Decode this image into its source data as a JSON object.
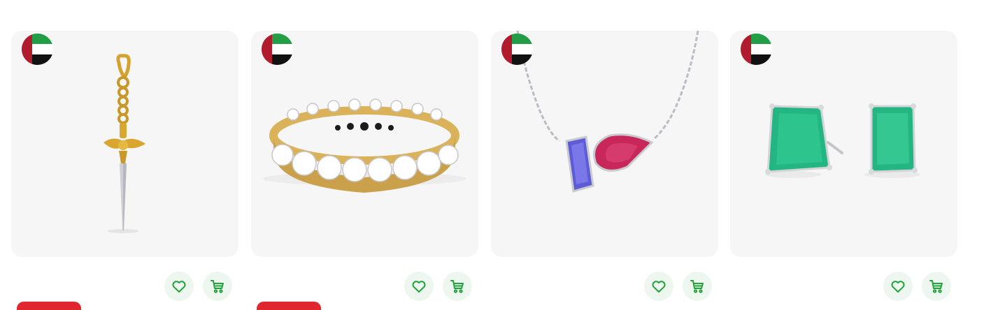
{
  "colors": {
    "card_bg": "#f6f6f6",
    "accent_green": "#1fa33a",
    "action_bg": "#eef7ef",
    "sale_red": "#e0262e",
    "flag_green": "#239e46",
    "flag_red": "#b01c2e",
    "flag_black": "#111111"
  },
  "products": [
    {
      "flag_icon": "uae-flag-icon",
      "image": "gold-dagger-pendant-charm",
      "has_badge": true,
      "actions": [
        "heart-icon",
        "cart-icon"
      ]
    },
    {
      "flag_icon": "uae-flag-icon",
      "image": "gold-eternity-ring-with-clear-stones",
      "has_badge": true,
      "actions": [
        "heart-icon",
        "cart-icon"
      ]
    },
    {
      "flag_icon": "uae-flag-icon",
      "image": "silver-necklace-blue-and-pink-stones",
      "has_badge": false,
      "actions": [
        "heart-icon",
        "cart-icon"
      ]
    },
    {
      "flag_icon": "uae-flag-icon",
      "image": "green-emerald-stud-earrings",
      "has_badge": false,
      "actions": [
        "heart-icon",
        "cart-icon"
      ]
    }
  ]
}
